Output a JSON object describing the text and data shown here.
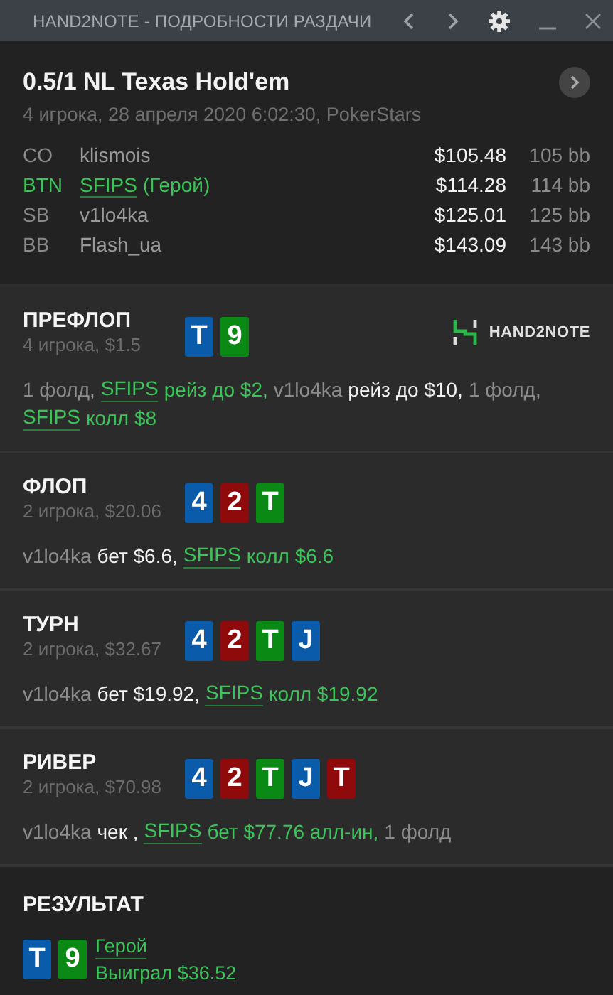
{
  "window": {
    "title": "HAND2NOTE - ПОДРОБНОСТИ РАЗДАЧИ"
  },
  "hand": {
    "title": "0.5/1 NL Texas Hold'em",
    "subtitle": "4 игрока, 28 апреля 2020 6:02:30, PokerStars",
    "players": [
      {
        "position": "CO",
        "name": "klismois",
        "hero": false,
        "stack": "$105.48",
        "bb": "105 bb"
      },
      {
        "position": "BTN",
        "name": "SFIPS",
        "hero": true,
        "tag": "(Герой)",
        "stack": "$114.28",
        "bb": "114 bb"
      },
      {
        "position": "SB",
        "name": "v1lo4ka",
        "hero": false,
        "stack": "$125.01",
        "bb": "125 bb"
      },
      {
        "position": "BB",
        "name": "Flash_ua",
        "hero": false,
        "stack": "$143.09",
        "bb": "143 bb"
      }
    ]
  },
  "logo": "HAND2NOTE",
  "streets": [
    {
      "name": "ПРЕФЛОП",
      "info": "4 игрока, $1.5",
      "cards": [
        {
          "rank": "T",
          "color": "#0b5bab"
        },
        {
          "rank": "9",
          "color": "#0a8a14"
        }
      ],
      "actions": [
        {
          "kind": "muted",
          "text": "1 фолд,"
        },
        {
          "kind": "hero-link",
          "text": "SFIPS"
        },
        {
          "kind": "hero",
          "text": "рейз до $2,"
        },
        {
          "kind": "muted",
          "text": "v1lo4ka"
        },
        {
          "kind": "action",
          "text": "рейз до $10,"
        },
        {
          "kind": "muted",
          "text": "1 фолд,"
        },
        {
          "kind": "hero-link",
          "text": "SFIPS"
        },
        {
          "kind": "hero",
          "text": "колл $8"
        }
      ]
    },
    {
      "name": "ФЛОП",
      "info": "2 игрока, $20.06",
      "cards": [
        {
          "rank": "4",
          "color": "#0b5bab"
        },
        {
          "rank": "2",
          "color": "#8f0a0a"
        },
        {
          "rank": "T",
          "color": "#0a8a14"
        }
      ],
      "actions": [
        {
          "kind": "muted",
          "text": "v1lo4ka"
        },
        {
          "kind": "action",
          "text": "бет $6.6,"
        },
        {
          "kind": "hero-link",
          "text": "SFIPS"
        },
        {
          "kind": "hero",
          "text": "колл $6.6"
        }
      ]
    },
    {
      "name": "ТУРН",
      "info": "2 игрока, $32.67",
      "cards": [
        {
          "rank": "4",
          "color": "#0b5bab"
        },
        {
          "rank": "2",
          "color": "#8f0a0a"
        },
        {
          "rank": "T",
          "color": "#0a8a14"
        },
        {
          "rank": "J",
          "color": "#0b5bab"
        }
      ],
      "actions": [
        {
          "kind": "muted",
          "text": "v1lo4ka"
        },
        {
          "kind": "action",
          "text": "бет $19.92,"
        },
        {
          "kind": "hero-link",
          "text": "SFIPS"
        },
        {
          "kind": "hero",
          "text": "колл $19.92"
        }
      ]
    },
    {
      "name": "РИВЕР",
      "info": "2 игрока, $70.98",
      "cards": [
        {
          "rank": "4",
          "color": "#0b5bab"
        },
        {
          "rank": "2",
          "color": "#8f0a0a"
        },
        {
          "rank": "T",
          "color": "#0a8a14"
        },
        {
          "rank": "J",
          "color": "#0b5bab"
        },
        {
          "rank": "T",
          "color": "#8f0a0a"
        }
      ],
      "actions": [
        {
          "kind": "muted",
          "text": "v1lo4ka"
        },
        {
          "kind": "action",
          "text": "чек ,"
        },
        {
          "kind": "hero-link",
          "text": "SFIPS"
        },
        {
          "kind": "hero",
          "text": "бет $77.76 алл-ин,"
        },
        {
          "kind": "muted",
          "text": "1 фолд"
        }
      ]
    }
  ],
  "result": {
    "title": "РЕЗУЛЬТАТ",
    "cards": [
      {
        "rank": "T",
        "color": "#0b5bab"
      },
      {
        "rank": "9",
        "color": "#0a8a14"
      }
    ],
    "player": "Герой",
    "outcome": "Выиграл $36.52"
  }
}
